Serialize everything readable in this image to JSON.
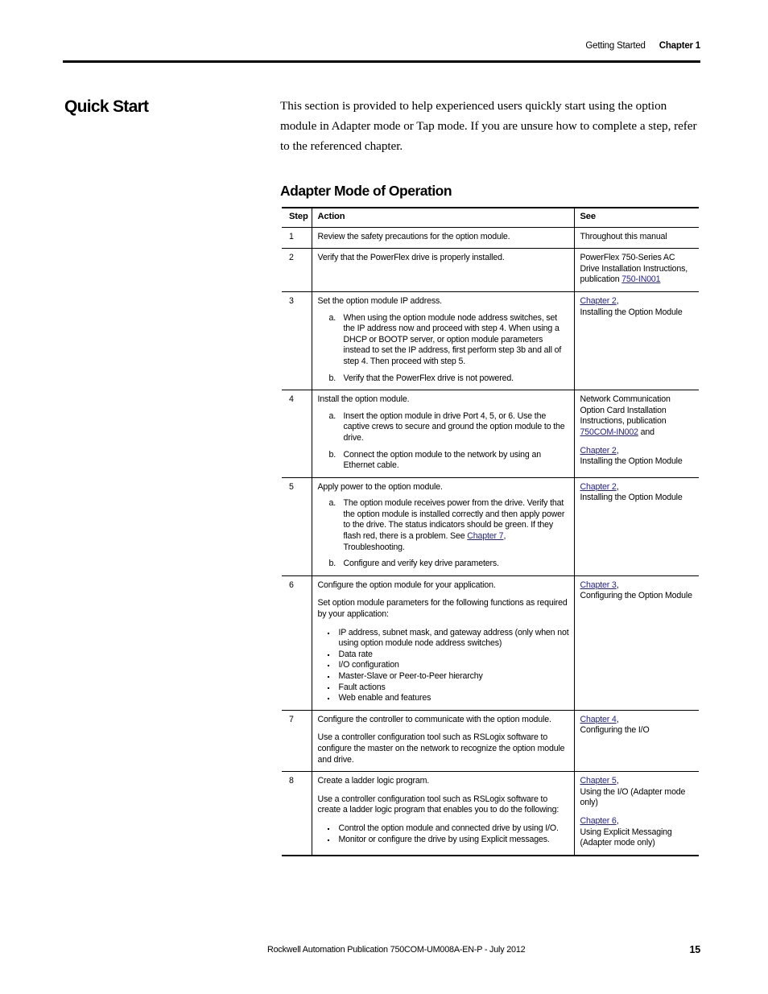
{
  "header": {
    "section": "Getting Started",
    "chapter": "Chapter 1"
  },
  "section_title": "Quick Start",
  "intro": "This section is provided to help experienced users quickly start using the option module in Adapter mode or Tap mode. If you are unsure how to complete a step, refer to the referenced chapter.",
  "subsection_title": "Adapter Mode of Operation",
  "table": {
    "columns": [
      "Step",
      "Action",
      "See"
    ],
    "rows": [
      {
        "step": "1",
        "action": {
          "lead": "Review the safety precautions for the option module."
        },
        "see": {
          "p1": "Throughout this manual"
        }
      },
      {
        "step": "2",
        "action": {
          "lead": "Verify that the PowerFlex drive is properly installed."
        },
        "see": {
          "p1_pre": "PowerFlex 750-Series AC Drive Installation Instructions, publication ",
          "p1_link": "750-IN001"
        }
      },
      {
        "step": "3",
        "action": {
          "lead": "Set the option module IP address.",
          "sub_a_label": "a.",
          "sub_a": "When using the option module node address switches, set the IP address now and proceed with step 4. When using a DHCP or BOOTP server, or option module parameters instead to set the IP address, first perform step 3b and all of step 4. Then proceed with step 5.",
          "sub_b_label": "b.",
          "sub_b": "Verify that the PowerFlex drive is not powered."
        },
        "see": {
          "p1_link": "Chapter 2",
          "p1_post": ",",
          "p1_line2": "Installing the Option Module"
        }
      },
      {
        "step": "4",
        "action": {
          "lead": "Install the option module.",
          "sub_a_label": "a.",
          "sub_a": "Insert the option module in drive Port 4, 5, or 6. Use the captive crews to secure and ground the option module to the drive.",
          "sub_b_label": "b.",
          "sub_b": "Connect the option module to the network by using an Ethernet cable."
        },
        "see": {
          "p1_pre": "Network Communication Option Card Installation Instructions, publication ",
          "p1_link": "750COM-IN002",
          "p1_post": " and",
          "p2_link": "Chapter 2",
          "p2_post": ",",
          "p2_line2": "Installing the Option Module"
        }
      },
      {
        "step": "5",
        "action": {
          "lead": "Apply power to the option module.",
          "sub_a_label": "a.",
          "sub_a_pre": "The option module receives power from the drive. Verify that the option module is installed correctly and then apply power to the drive. The status indicators should be green. If they flash red, there is a problem. See ",
          "sub_a_link": "Chapter 7",
          "sub_a_post": ", Troubleshooting.",
          "sub_b_label": "b.",
          "sub_b": "Configure and verify key drive parameters."
        },
        "see": {
          "p1_link": "Chapter 2",
          "p1_post": ",",
          "p1_line2": "Installing the Option Module"
        }
      },
      {
        "step": "6",
        "action": {
          "lead": "Configure the option module for your application.",
          "para2": "Set option module parameters for the following functions as required by your application:",
          "bullets": [
            "IP address, subnet mask, and gateway address (only when not using option module node address switches)",
            "Data rate",
            "I/O configuration",
            "Master-Slave or Peer-to-Peer hierarchy",
            "Fault actions",
            "Web enable and features"
          ]
        },
        "see": {
          "p1_link": "Chapter 3",
          "p1_post": ",",
          "p1_line2": "Configuring the Option Module"
        }
      },
      {
        "step": "7",
        "action": {
          "lead": "Configure the controller to communicate with the option module.",
          "para2": "Use a controller configuration tool such as RSLogix software to configure the master on the network to recognize the option module and drive."
        },
        "see": {
          "p1_link": "Chapter 4",
          "p1_post": ",",
          "p1_line2": "Configuring the I/O"
        }
      },
      {
        "step": "8",
        "action": {
          "lead": "Create a ladder logic program.",
          "para2": "Use a controller configuration tool such as RSLogix software to create a ladder logic program that enables you to do the following:",
          "bullets": [
            "Control the option module and connected drive by using I/O.",
            "Monitor or configure the drive by using Explicit messages."
          ]
        },
        "see": {
          "p1_link": "Chapter 5",
          "p1_post": ",",
          "p1_line2": "Using the I/O (Adapter mode only)",
          "p2_link": "Chapter 6",
          "p2_post": ",",
          "p2_line2": "Using Explicit Messaging (Adapter mode only)"
        }
      }
    ]
  },
  "footer": {
    "publication": "Rockwell Automation Publication 750COM-UM008A-EN-P - July 2012",
    "page_number": "15"
  },
  "colors": {
    "link": "#22229c",
    "rule": "#000000"
  }
}
